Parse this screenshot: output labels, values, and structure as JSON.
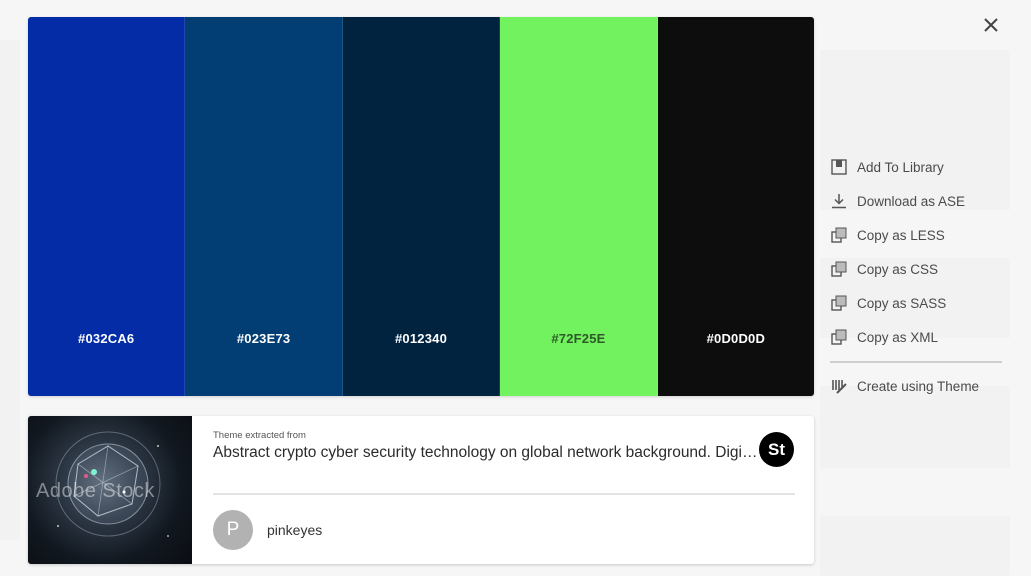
{
  "swatches": [
    {
      "hex_label": "#032CA6",
      "color": "#032CA6",
      "text_color": "#ffffff"
    },
    {
      "hex_label": "#023E73",
      "color": "#023E73",
      "text_color": "#ffffff"
    },
    {
      "hex_label": "#012340",
      "color": "#012340",
      "text_color": "#ffffff"
    },
    {
      "hex_label": "#72F25E",
      "color": "#72F25E",
      "text_color": "#2e5a2a"
    },
    {
      "hex_label": "#0D0D0D",
      "color": "#0D0D0D",
      "text_color": "#ffffff"
    }
  ],
  "menu": {
    "add_to_library": "Add To Library",
    "download_ase": "Download as ASE",
    "copy_less": "Copy as LESS",
    "copy_css": "Copy as CSS",
    "copy_sass": "Copy as SASS",
    "copy_xml": "Copy as XML",
    "create_theme": "Create using Theme"
  },
  "source": {
    "extracted_label": "Theme extracted from",
    "title": "Abstract crypto cyber security technology on global network background. Digital data protection concept",
    "badge": "St",
    "watermark": "Adobe Stock"
  },
  "author": {
    "initial": "P",
    "name": "pinkeyes"
  },
  "icons": {
    "close": "close-icon",
    "library": "library-icon",
    "download": "download-icon",
    "copy": "copy-icon",
    "create": "palette-icon"
  }
}
